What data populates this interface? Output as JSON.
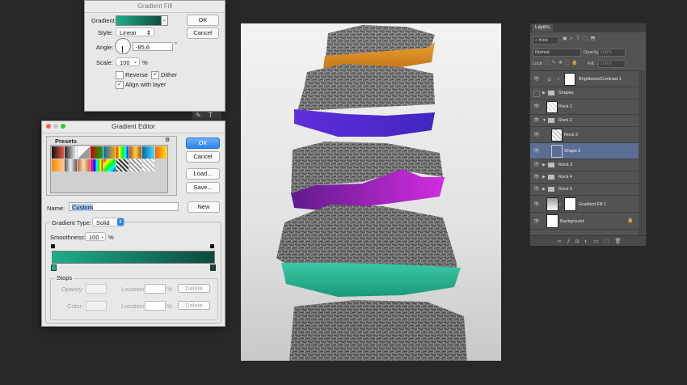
{
  "gradient_fill": {
    "title": "Gradient Fill",
    "gradient_label": "Gradient:",
    "style_label": "Style:",
    "style_value": "Linear",
    "angle_label": "Angle:",
    "angle_value": "-85,6",
    "angle_unit": "°",
    "scale_label": "Scale:",
    "scale_value": "100",
    "scale_unit": "%",
    "reverse_label": "Reverse",
    "dither_label": "Dither",
    "align_label": "Align with layer",
    "ok_label": "OK",
    "cancel_label": "Cancel"
  },
  "gradient_editor": {
    "title": "Gradient Editor",
    "presets_label": "Presets",
    "ok_label": "OK",
    "cancel_label": "Cancel",
    "load_label": "Load...",
    "save_label": "Save...",
    "name_label": "Name:",
    "name_value": "Custom",
    "new_label": "New",
    "gradient_type_label": "Gradient Type:",
    "gradient_type_value": "Solid",
    "smoothness_label": "Smoothness:",
    "smoothness_value": "100",
    "smoothness_unit": "%",
    "stops_label": "Stops",
    "opacity_label": "Opacity:",
    "color_label": "Color:",
    "location_label": "Location:",
    "location_unit": "%",
    "delete_label": "Delete"
  },
  "layers_panel": {
    "tab_label": "Layers",
    "kind_label": "Kind",
    "blend_mode": "Normal",
    "opacity_label": "Opacity:",
    "opacity_value": "100%",
    "lock_label": "Lock:",
    "fill_label": "Fill:",
    "fill_value": "100%",
    "layers": [
      {
        "name": "Brightness/Contrast 1"
      },
      {
        "name": "Shapes"
      },
      {
        "name": "Rock 1"
      },
      {
        "name": "Rock 2"
      },
      {
        "name": "Rock 2"
      },
      {
        "name": "Shape 2"
      },
      {
        "name": "Rock 3"
      },
      {
        "name": "Rock 4"
      },
      {
        "name": "Rock 5"
      },
      {
        "name": "Gradient Fill 1"
      },
      {
        "name": "Background"
      }
    ]
  },
  "colors": {
    "gradient_start": "#1fae8a",
    "gradient_end": "#0d4a3c",
    "rock_top": "#f0941c",
    "rock_band_2": "#4a22e6",
    "rock_band_3": "#cc1be0",
    "rock_band_4": "#2ac8a0",
    "selected_layer": "#5b6f96"
  }
}
